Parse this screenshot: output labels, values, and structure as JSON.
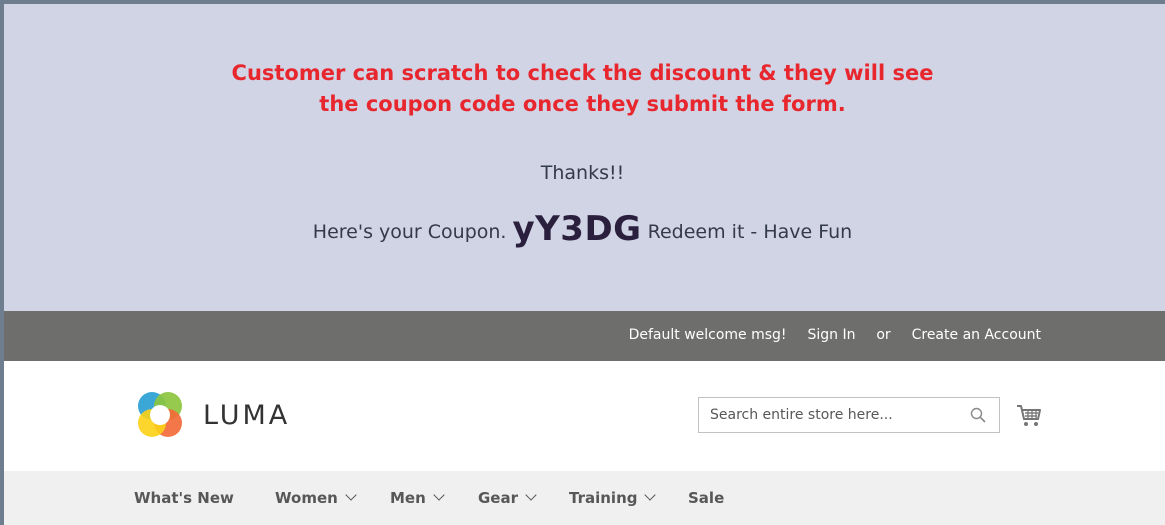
{
  "promo": {
    "headline_line1": "Customer can scratch to check the discount & they will see",
    "headline_line2": "the coupon code once they submit the form.",
    "thanks": "Thanks!!",
    "coupon_prefix": "Here's your Coupon.",
    "coupon_code": "yY3DG",
    "coupon_suffix": "Redeem it - Have Fun",
    "headline_color": "#e8262d",
    "background_color": "#d0d4e5"
  },
  "topbar": {
    "welcome": "Default welcome msg!",
    "sign_in": "Sign In",
    "or": "or",
    "create_account": "Create an Account"
  },
  "header": {
    "logo_text": "LUMA",
    "search_placeholder": "Search entire store here...",
    "search_icon": "search-icon",
    "cart_icon": "cart-icon"
  },
  "nav": {
    "items": [
      {
        "label": "What's New",
        "has_dropdown": false
      },
      {
        "label": "Women",
        "has_dropdown": true
      },
      {
        "label": "Men",
        "has_dropdown": true
      },
      {
        "label": "Gear",
        "has_dropdown": true
      },
      {
        "label": "Training",
        "has_dropdown": true
      },
      {
        "label": "Sale",
        "has_dropdown": false
      }
    ]
  }
}
